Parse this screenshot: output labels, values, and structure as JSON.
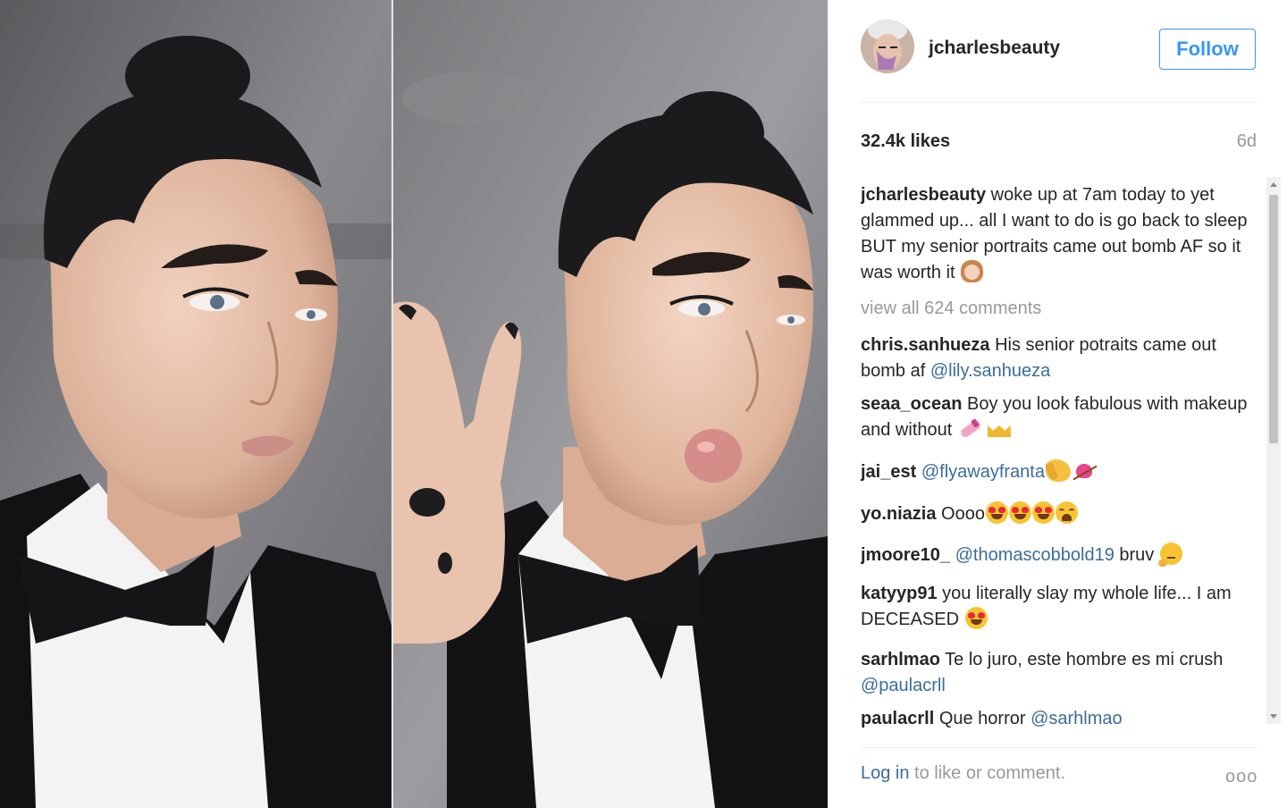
{
  "post": {
    "username": "jcharlesbeauty",
    "follow_label": "Follow",
    "likes": "32.4k likes",
    "age": "6d"
  },
  "caption": {
    "user": "jcharlesbeauty",
    "text": " woke up at 7am today to yet glammed up... all I want to do is go back to sleep BUT my senior portraits came out bomb AF so it was worth it "
  },
  "view_all": "view all 624 comments",
  "comments": [
    {
      "user": "chris.sanhueza",
      "text": " His senior potraits came out bomb af ",
      "mention": "@lily.sanhueza"
    },
    {
      "user": "seaa_ocean",
      "text": " Boy you look fabulous with makeup and without "
    },
    {
      "user": "jai_est",
      "text": " ",
      "mention": "@flyawayfranta"
    },
    {
      "user": "yo.niazia",
      "text": " Oooo"
    },
    {
      "user": "jmoore10_",
      "text": " ",
      "mention": "@thomascobbold19",
      "tail": " bruv "
    },
    {
      "user": "katyyp91",
      "text": " you literally slay my whole life... I am DECEASED "
    },
    {
      "user": "sarhlmao",
      "text": " Te lo juro, este hombre es mi crush ",
      "mention": "@paulacrll"
    },
    {
      "user": "paulacrll",
      "text": " Que horror ",
      "mention": "@sarhlmao"
    }
  ],
  "footer": {
    "login": "Log in",
    "rest": " to like or comment.",
    "more": "ooo"
  },
  "colors": {
    "follow_blue": "#3897f0",
    "mention_blue": "#3b6d98",
    "muted": "#999999"
  }
}
